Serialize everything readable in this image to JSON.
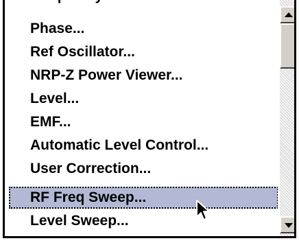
{
  "menu": {
    "items": [
      {
        "label": "Frequency..."
      },
      {
        "label": "Phase..."
      },
      {
        "label": "Ref Oscillator..."
      },
      {
        "label": "NRP-Z Power Viewer..."
      },
      {
        "label": "Level..."
      },
      {
        "label": "EMF..."
      },
      {
        "label": "Automatic Level Control..."
      },
      {
        "label": "User Correction..."
      },
      {
        "label": "RF Freq Sweep..."
      },
      {
        "label": "Level Sweep..."
      }
    ],
    "selected_index": 8
  },
  "icons": {
    "scroll_up": "arrow-up-icon",
    "scroll_down": "arrow-down-icon",
    "cursor": "mouse-pointer-icon"
  },
  "colors": {
    "selection_bg": "#b3b9d4",
    "text": "#000000",
    "button_face": "#d4d0c8"
  }
}
